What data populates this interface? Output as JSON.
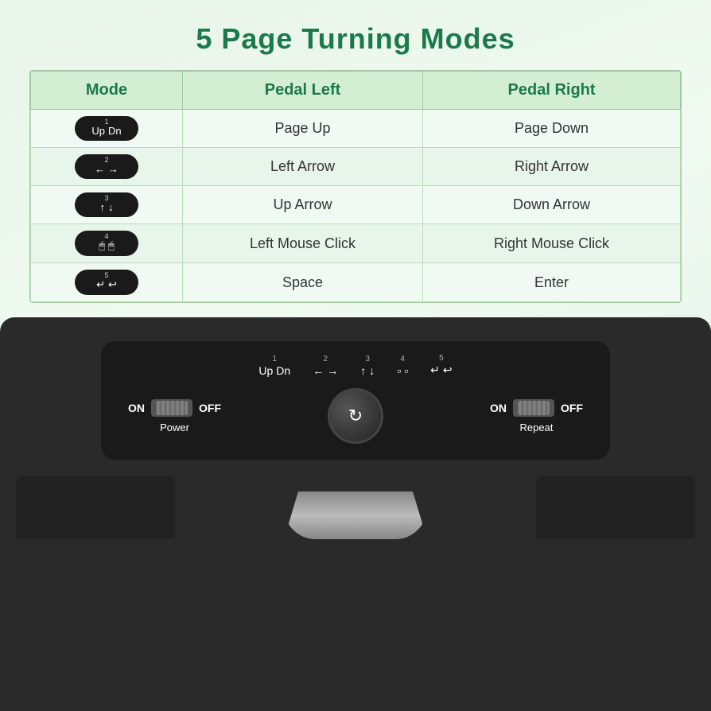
{
  "title": "5 Page Turning Modes",
  "table": {
    "headers": [
      "Mode",
      "Pedal Left",
      "Pedal Right"
    ],
    "rows": [
      {
        "mode_num": "1",
        "mode_icons_left": "Up",
        "mode_icons_right": "Dn",
        "pedal_left": "Page Up",
        "pedal_right": "Page Down"
      },
      {
        "mode_num": "2",
        "mode_icons_left": "←",
        "mode_icons_right": "→",
        "pedal_left": "Left Arrow",
        "pedal_right": "Right Arrow"
      },
      {
        "mode_num": "3",
        "mode_icons_left": "↑",
        "mode_icons_right": "↓",
        "pedal_left": "Up Arrow",
        "pedal_right": "Down Arrow"
      },
      {
        "mode_num": "4",
        "mode_icons_left": "🖱",
        "mode_icons_right": "🖱",
        "pedal_left": "Left Mouse Click",
        "pedal_right": "Right Mouse Click"
      },
      {
        "mode_num": "5",
        "mode_icons_left": "↵",
        "mode_icons_right": "↩",
        "pedal_left": "Space",
        "pedal_right": "Enter"
      }
    ]
  },
  "hardware": {
    "mode_indicators": [
      {
        "num": "1",
        "icons": [
          "Up",
          "Dn"
        ]
      },
      {
        "num": "2",
        "icons": [
          "←",
          "→"
        ]
      },
      {
        "num": "3",
        "icons": [
          "↑",
          "↓"
        ]
      },
      {
        "num": "4",
        "icons": [
          "▪",
          "▪"
        ]
      },
      {
        "num": "5",
        "icons": [
          "↵",
          "↩"
        ]
      }
    ],
    "power_switch": {
      "on_label": "ON",
      "off_label": "OFF",
      "label": "Power"
    },
    "repeat_switch": {
      "on_label": "ON",
      "off_label": "OFF",
      "label": "Repeat"
    }
  }
}
